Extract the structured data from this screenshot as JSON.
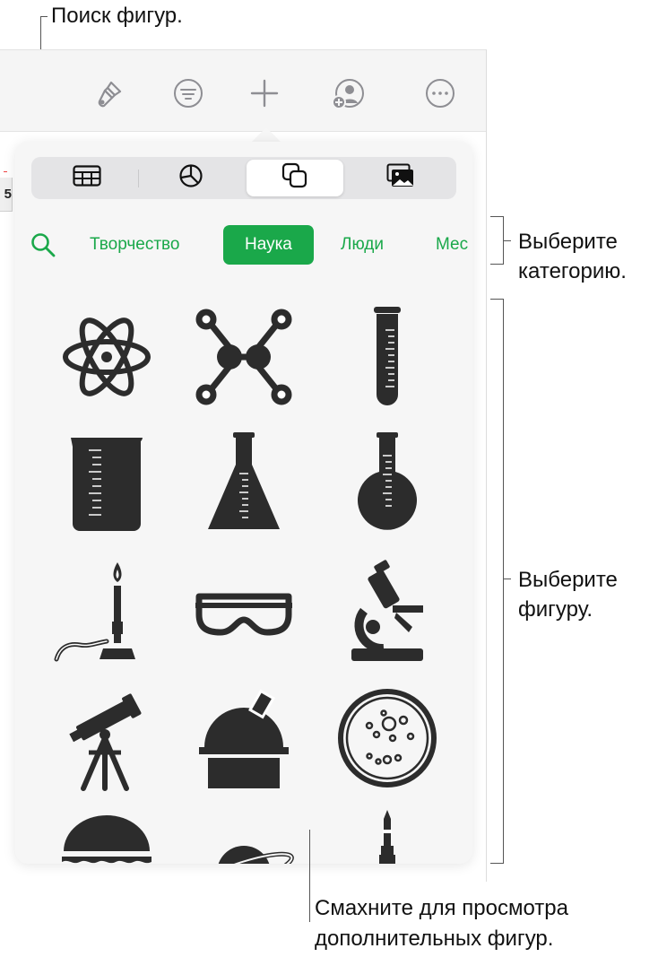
{
  "callouts": {
    "search_shapes": "Поиск фигур.",
    "choose_category_line1": "Выберите",
    "choose_category_line2": "категорию.",
    "choose_shape_line1": "Выберите",
    "choose_shape_line2": "фигуру.",
    "swipe_line1": "Смахните для просмотра",
    "swipe_line2": "дополнительных фигур."
  },
  "document": {
    "row_header_label": "5"
  },
  "toolbar": {
    "icons": [
      "paintbrush-icon",
      "filter-icon",
      "plus-icon",
      "add-collaborator-icon",
      "more-icon"
    ]
  },
  "insert_tabs": [
    {
      "name": "table-icon",
      "active": false
    },
    {
      "name": "chart-icon",
      "active": false
    },
    {
      "name": "shapes-icon",
      "active": true
    },
    {
      "name": "media-icon",
      "active": false
    }
  ],
  "categories": [
    {
      "label": "Творчество",
      "active": false
    },
    {
      "label": "Наука",
      "active": true
    },
    {
      "label": "Люди",
      "active": false
    },
    {
      "label": "Мес",
      "active": false
    }
  ],
  "shapes": [
    "atom-icon",
    "molecule-icon",
    "test-tube-icon",
    "beaker-icon",
    "erlenmeyer-flask-icon",
    "round-flask-icon",
    "bunsen-burner-icon",
    "safety-goggles-icon",
    "microscope-icon",
    "telescope-icon",
    "observatory-icon",
    "petri-dish-icon",
    "half-dome-icon",
    "planet-icon",
    "rocket-icon"
  ],
  "colors": {
    "accent_green": "#1aa84a",
    "icon_dark": "#2c2c2c",
    "toolbar_icon": "#8e8e93"
  }
}
